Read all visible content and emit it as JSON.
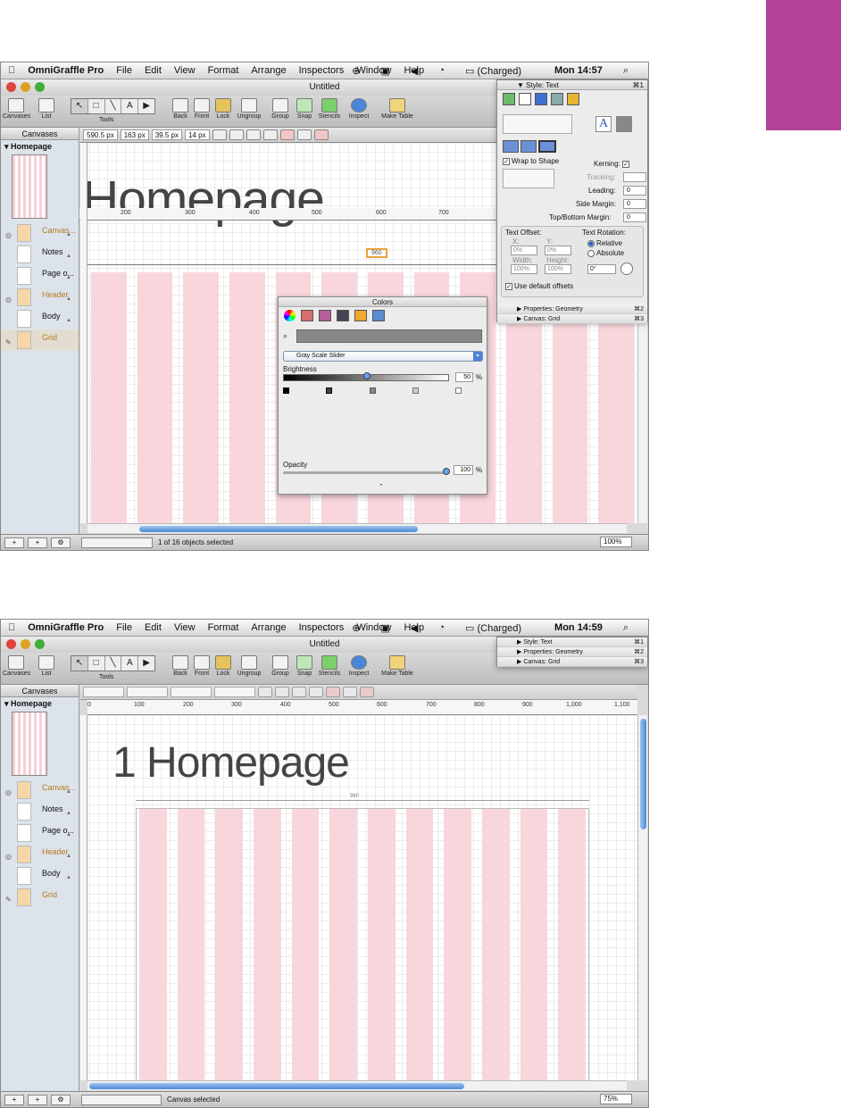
{
  "screens": [
    {
      "menubar": {
        "app": "OmniGraffle Pro",
        "items": [
          "File",
          "Edit",
          "View",
          "Format",
          "Arrange",
          "Inspectors",
          "Window",
          "Help"
        ],
        "battery": "(Charged)",
        "clock": "Mon 14:57"
      },
      "window_title": "Untitled",
      "toolbar": {
        "canvases": "Canvases",
        "list": "List",
        "tools_label": "Tools",
        "buttons": [
          "Back",
          "Front",
          "Lock",
          "Ungroup",
          "Group",
          "Snap",
          "Stencils",
          "Inspect",
          "Make Table"
        ]
      },
      "inspector_bar": {
        "x": "590.5 px",
        "y": "163 px",
        "w": "39.5 px",
        "h": "14 px"
      },
      "ruler": [
        "200",
        "300",
        "400",
        "500",
        "600",
        "700"
      ],
      "sidebar": {
        "header": "Canvases",
        "page": "Homepage",
        "layers": [
          "Canvas...",
          "Notes",
          "Page o...",
          "Header",
          "Body",
          "Grid"
        ]
      },
      "canvas": {
        "title": "Homepage",
        "selection_label": "960"
      },
      "style_panel": {
        "title": "Style: Text",
        "shortcut": "⌘1",
        "wrap_to_shape": "Wrap to Shape",
        "kerning": "Kerning:",
        "tracking": "Tracking:",
        "leading": "Leading:",
        "leading_val": "0",
        "side_margin": "Side Margin:",
        "side_margin_val": "0",
        "top_bottom_margin": "Top/Bottom Margin:",
        "top_bottom_val": "0",
        "text_offset": "Text Offset:",
        "text_rotation": "Text Rotation:",
        "x_label": "X:",
        "y_label": "Y:",
        "x_val": "0%",
        "y_val": "0%",
        "width_label": "Width:",
        "height_label": "Height:",
        "width_val": "100%",
        "height_val": "100%",
        "relative": "Relative",
        "absolute": "Absolute",
        "angle": "0°",
        "use_default": "Use default offsets",
        "row2": "Properties: Geometry",
        "row2_key": "⌘2",
        "row3": "Canvas: Grid",
        "row3_key": "⌘3"
      },
      "colors_panel": {
        "title": "Colors",
        "mode": "Gray Scale Slider",
        "brightness": "Brightness",
        "brightness_val": "50",
        "opacity": "Opacity",
        "opacity_val": "100",
        "percent": "%"
      },
      "status": {
        "text": "1 of 16 objects selected",
        "zoom": "100%"
      }
    },
    {
      "menubar": {
        "app": "OmniGraffle Pro",
        "items": [
          "File",
          "Edit",
          "View",
          "Format",
          "Arrange",
          "Inspectors",
          "Window",
          "Help"
        ],
        "battery": "(Charged)",
        "clock": "Mon 14:59"
      },
      "window_title": "Untitled",
      "toolbar": {
        "canvases": "Canvases",
        "list": "List",
        "tools_label": "Tools",
        "buttons": [
          "Back",
          "Front",
          "Lock",
          "Ungroup",
          "Group",
          "Snap",
          "Stencils",
          "Inspect",
          "Make Table"
        ]
      },
      "ruler": [
        "0",
        "100",
        "200",
        "300",
        "400",
        "500",
        "600",
        "700",
        "800",
        "900",
        "1,000",
        "1,100"
      ],
      "sidebar": {
        "header": "Canvases",
        "page": "Homepage",
        "layers": [
          "Canvas...",
          "Notes",
          "Page o...",
          "Header",
          "Body",
          "Grid"
        ]
      },
      "canvas": {
        "title": "1 Homepage",
        "width_label": "960"
      },
      "collapsed_panel": [
        {
          "label": "Style: Text",
          "key": "⌘1"
        },
        {
          "label": "Properties: Geometry",
          "key": "⌘2"
        },
        {
          "label": "Canvas: Grid",
          "key": "⌘3"
        }
      ],
      "status": {
        "text": "Canvas selected",
        "zoom": "75%"
      }
    }
  ],
  "colors": {
    "accent_tab": "#b34197",
    "grid_pink": "#f8d6dc",
    "layer_orange": "#f6d6a8",
    "scroll_blue": "#4d8ad7"
  }
}
